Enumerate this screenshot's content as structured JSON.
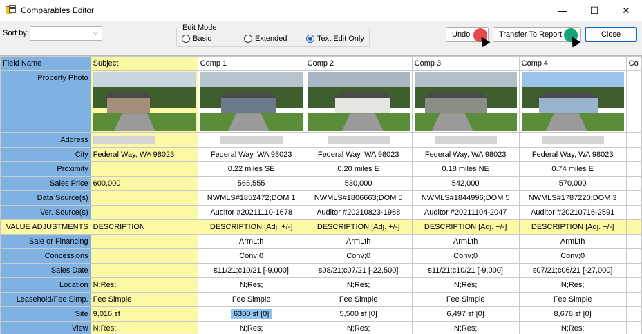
{
  "window": {
    "title": "Comparables Editor",
    "minimize": "—",
    "maximize": "☐",
    "close": "✕"
  },
  "toolbar": {
    "sort_label": "Sort by:",
    "sort_value": "",
    "edit_mode_label": "Edit Mode",
    "modes": [
      "Basic",
      "Extended",
      "Text Edit Only"
    ],
    "selected_mode": "Text Edit Only",
    "undo": "Undo",
    "transfer": "Transfer To Report",
    "close": "Close"
  },
  "columns": [
    "Field Name",
    "Subject",
    "Comp 1",
    "Comp 2",
    "Comp 3",
    "Comp 4",
    "Co"
  ],
  "rows": [
    {
      "field": "Property Photo",
      "subject": "",
      "comps": [
        "",
        "",
        "",
        ""
      ],
      "photo": true
    },
    {
      "field": "Address",
      "subject": "",
      "comps": [
        "",
        "",
        "",
        ""
      ],
      "redacted": true
    },
    {
      "field": "City",
      "subject": "Federal Way, WA 98023",
      "comps": [
        "Federal Way, WA 98023",
        "Federal Way, WA 98023",
        "Federal Way, WA 98023",
        "Federal Way, WA 98023"
      ]
    },
    {
      "field": "Proximity",
      "subject": "",
      "comps": [
        "0.22 miles SE",
        "0.20 miles E",
        "0.18 miles NE",
        "0.74 miles E"
      ]
    },
    {
      "field": "Sales Price",
      "subject": "600,000",
      "comps": [
        "565,555",
        "530,000",
        "542,000",
        "570,000"
      ]
    },
    {
      "field": "Data Source(s)",
      "subject": "",
      "comps": [
        "NWMLS#1852472;DOM 1",
        "NWMLS#1806663;DOM 5",
        "NWMLS#1844996;DOM 5",
        "NWMLS#1787220;DOM 3"
      ]
    },
    {
      "field": "Ver. Source(s)",
      "subject": "",
      "comps": [
        "Auditor #20211110-1678",
        "Auditor #20210823-1968",
        "Auditor #20211104-2047",
        "Auditor #20210716-2591"
      ]
    },
    {
      "field": "VALUE ADJUSTMENTS",
      "subject": "DESCRIPTION",
      "comps": [
        "DESCRIPTION [Adj. +/-]",
        "DESCRIPTION [Adj. +/-]",
        "DESCRIPTION [Adj. +/-]",
        "DESCRIPTION [Adj. +/-]"
      ],
      "value": true
    },
    {
      "field": "Sale or Financing",
      "subject": "",
      "comps": [
        "ArmLth",
        "ArmLth",
        "ArmLth",
        "ArmLth"
      ]
    },
    {
      "field": "Concessions",
      "subject": "",
      "comps": [
        "Conv;0",
        "Conv;0",
        "Conv;0",
        "Conv;0"
      ]
    },
    {
      "field": "Sales Date",
      "subject": "",
      "comps": [
        "s11/21;c10/21  [-9,000]",
        "s08/21;c07/21  [-22,500]",
        "s11/21;c10/21  [-9,000]",
        "s07/21;c06/21  [-27,000]"
      ]
    },
    {
      "field": "Location",
      "subject": "N;Res;",
      "comps": [
        "N;Res;",
        "N;Res;",
        "N;Res;",
        "N;Res;"
      ]
    },
    {
      "field": "Leasehold/Fee Simp.",
      "subject": "Fee Simple",
      "comps": [
        "Fee Simple",
        "Fee Simple",
        "Fee Simple",
        "Fee Simple"
      ]
    },
    {
      "field": "Site",
      "subject": "9,016 sf",
      "comps": [
        "6300 sf  [0]",
        "5,500 sf  [0]",
        "6,497 sf  [0]",
        "8,678 sf  [0]"
      ],
      "selected_comp": 0
    },
    {
      "field": "View",
      "subject": "N;Res;",
      "comps": [
        "N;Res;",
        "N;Res;",
        "N;Res;",
        "N;Res;"
      ]
    }
  ]
}
